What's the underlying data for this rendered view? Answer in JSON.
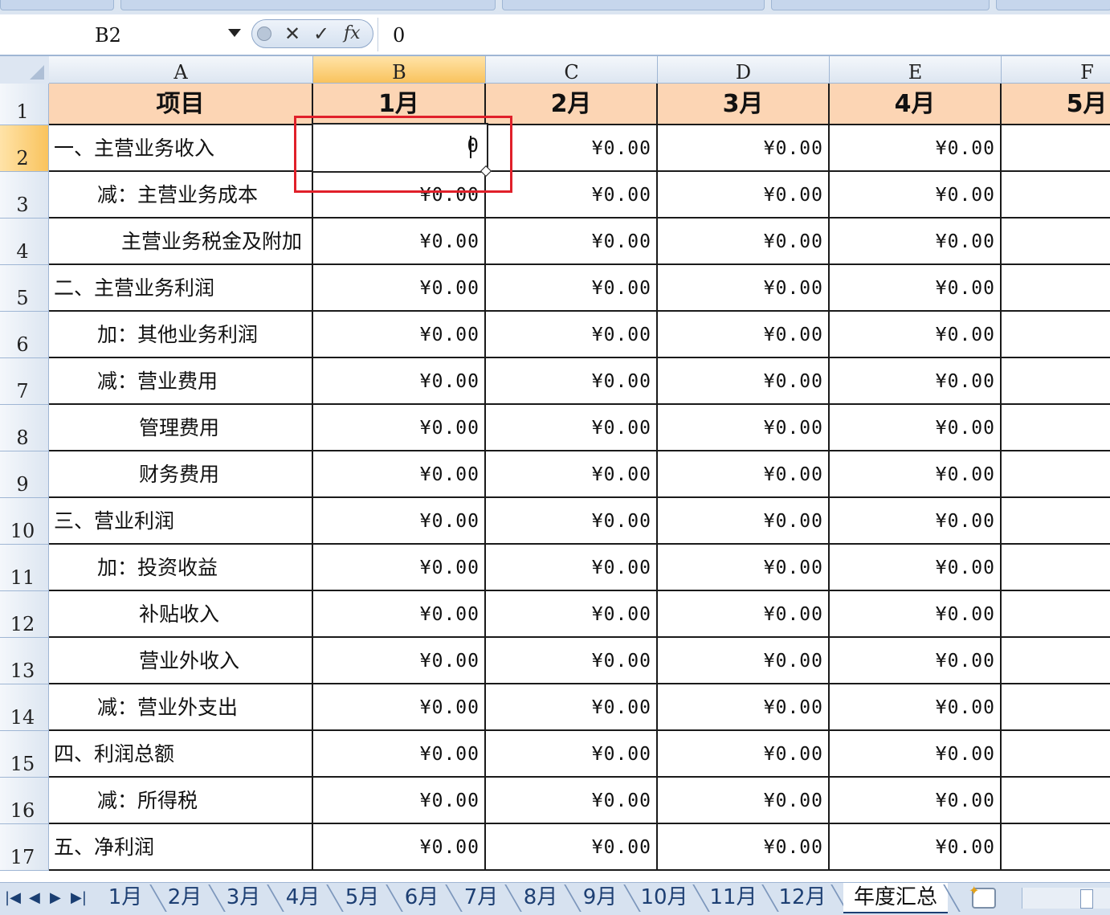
{
  "formula_bar": {
    "name_box": "B2",
    "cancel_icon": "✕",
    "enter_icon": "✓",
    "function_icon": "fx",
    "formula_value": "0"
  },
  "columns": [
    "A",
    "B",
    "C",
    "D",
    "E",
    "F"
  ],
  "header_row": [
    "项目",
    "1月",
    "2月",
    "3月",
    "4月",
    "5月"
  ],
  "rows": [
    {
      "num": "2",
      "label": "一、主营业务收入",
      "indent": 0,
      "values": [
        "",
        "¥0.00",
        "¥0.00",
        "¥0.00"
      ]
    },
    {
      "num": "3",
      "label": "减：主营业务成本",
      "indent": 2,
      "values": [
        "¥0.00",
        "¥0.00",
        "¥0.00",
        "¥0.00"
      ]
    },
    {
      "num": "4",
      "label": "主营业务税金及附加",
      "indent": 3,
      "values": [
        "¥0.00",
        "¥0.00",
        "¥0.00",
        "¥0.00"
      ]
    },
    {
      "num": "5",
      "label": "二、主营业务利润",
      "indent": 0,
      "values": [
        "¥0.00",
        "¥0.00",
        "¥0.00",
        "¥0.00"
      ]
    },
    {
      "num": "6",
      "label": "加：其他业务利润",
      "indent": 2,
      "values": [
        "¥0.00",
        "¥0.00",
        "¥0.00",
        "¥0.00"
      ]
    },
    {
      "num": "7",
      "label": "减：营业费用",
      "indent": 2,
      "values": [
        "¥0.00",
        "¥0.00",
        "¥0.00",
        "¥0.00"
      ]
    },
    {
      "num": "8",
      "label": "管理费用",
      "indent": 4,
      "values": [
        "¥0.00",
        "¥0.00",
        "¥0.00",
        "¥0.00"
      ]
    },
    {
      "num": "9",
      "label": "财务费用",
      "indent": 4,
      "values": [
        "¥0.00",
        "¥0.00",
        "¥0.00",
        "¥0.00"
      ]
    },
    {
      "num": "10",
      "label": "三、营业利润",
      "indent": 0,
      "values": [
        "¥0.00",
        "¥0.00",
        "¥0.00",
        "¥0.00"
      ]
    },
    {
      "num": "11",
      "label": "加：投资收益",
      "indent": 2,
      "values": [
        "¥0.00",
        "¥0.00",
        "¥0.00",
        "¥0.00"
      ]
    },
    {
      "num": "12",
      "label": "补贴收入",
      "indent": 4,
      "values": [
        "¥0.00",
        "¥0.00",
        "¥0.00",
        "¥0.00"
      ]
    },
    {
      "num": "13",
      "label": "营业外收入",
      "indent": 4,
      "values": [
        "¥0.00",
        "¥0.00",
        "¥0.00",
        "¥0.00"
      ]
    },
    {
      "num": "14",
      "label": "减：营业外支出",
      "indent": 2,
      "values": [
        "¥0.00",
        "¥0.00",
        "¥0.00",
        "¥0.00"
      ]
    },
    {
      "num": "15",
      "label": "四、利润总额",
      "indent": 0,
      "values": [
        "¥0.00",
        "¥0.00",
        "¥0.00",
        "¥0.00"
      ]
    },
    {
      "num": "16",
      "label": "减：所得税",
      "indent": 2,
      "values": [
        "¥0.00",
        "¥0.00",
        "¥0.00",
        "¥0.00"
      ]
    },
    {
      "num": "17",
      "label": "五、净利润",
      "indent": 0,
      "values": [
        "¥0.00",
        "¥0.00",
        "¥0.00",
        "¥0.00"
      ]
    }
  ],
  "active_cell": {
    "ref": "B2",
    "value": "0"
  },
  "sheet_tabs": [
    "1月",
    "2月",
    "3月",
    "4月",
    "5月",
    "6月",
    "7月",
    "8月",
    "9月",
    "10月",
    "11月",
    "12月",
    "年度汇总"
  ],
  "active_sheet": "年度汇总",
  "nav_icons": [
    "|◀",
    "◀",
    "▶",
    "▶|"
  ],
  "colors": {
    "header_fill": "#fcd5b4",
    "active_header": "#f9c35d",
    "highlight": "#e0202a"
  }
}
